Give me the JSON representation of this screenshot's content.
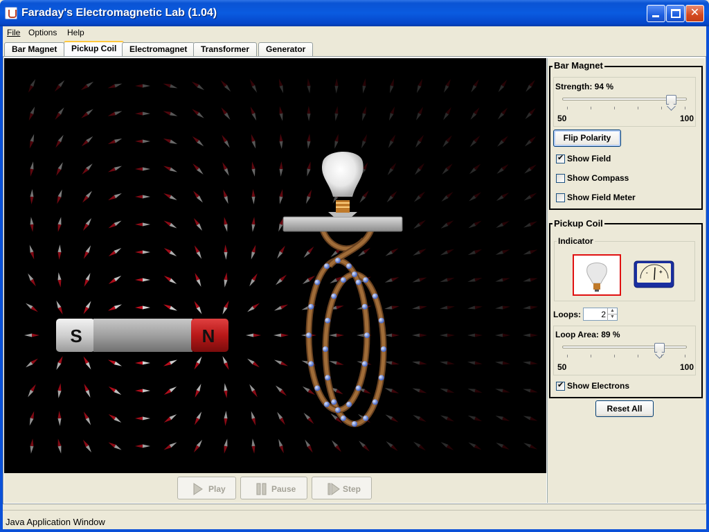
{
  "window": {
    "title": "Faraday's Electromagnetic Lab (1.04)"
  },
  "menu": [
    "File",
    "Options",
    "Help"
  ],
  "tabs": [
    "Bar Magnet",
    "Pickup Coil",
    "Electromagnet",
    "Transformer",
    "Generator"
  ],
  "active_tab": "Pickup Coil",
  "canvas": {
    "magnet_south": "S",
    "magnet_north": "N",
    "colors": {
      "background": "#000000",
      "north": "#c0181c",
      "south": "#d8d8d8",
      "coil": "#8a5a2b",
      "electron": "#7ea0e8"
    }
  },
  "playback": {
    "play": "Play",
    "pause": "Pause",
    "step": "Step"
  },
  "bar_magnet": {
    "title": "Bar Magnet",
    "strength_label": "Strength: 94 %",
    "strength_value": 94,
    "min": "50",
    "max": "100",
    "flip_label": "Flip Polarity",
    "show_field": "Show Field",
    "show_field_checked": true,
    "show_compass": "Show Compass",
    "show_compass_checked": false,
    "show_field_meter": "Show Field Meter",
    "show_field_meter_checked": false
  },
  "pickup_coil": {
    "title": "Pickup Coil",
    "indicator_title": "Indicator",
    "indicator_selected": "lightbulb",
    "loops_label": "Loops:",
    "loops_value": "2",
    "loop_area_label": "Loop Area: 89 %",
    "loop_area_value": 89,
    "min": "50",
    "max": "100",
    "show_electrons": "Show Electrons",
    "show_electrons_checked": true
  },
  "reset_label": "Reset All",
  "status": "Java Application Window"
}
